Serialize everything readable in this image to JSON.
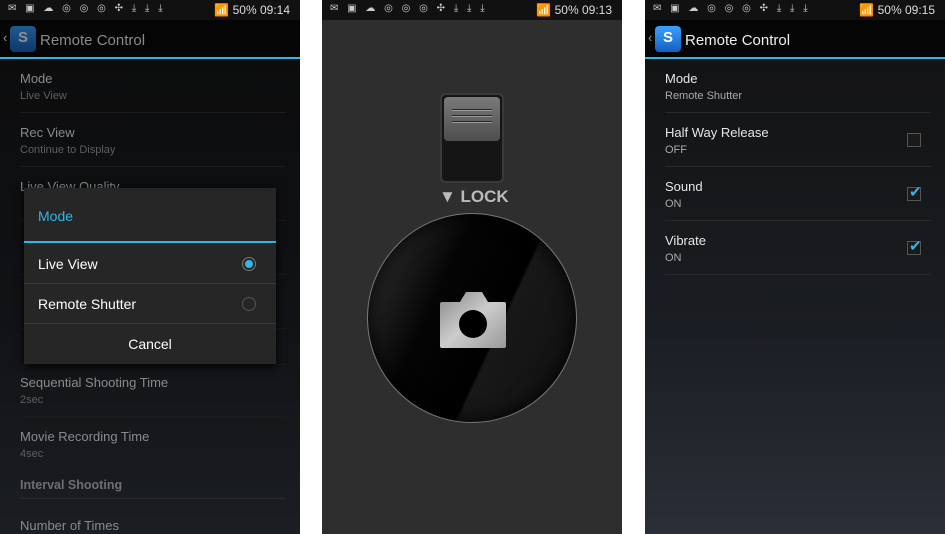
{
  "status_icons": "✉ ▣ ☁ ◎ ◎ ◎ ✣ ⤓ ⤓ ⤓",
  "screens": [
    {
      "status": {
        "battery": "50%",
        "time": "09:14"
      },
      "app_title": "Remote Control",
      "rows": [
        {
          "title": "Mode",
          "sub": "Live View"
        },
        {
          "title": "Rec View",
          "sub": "Continue to Display"
        },
        {
          "title": "Live View Quality",
          "sub": ""
        }
      ],
      "rows_below": [
        {
          "title": "Sequential Shooting Time",
          "sub": "2sec"
        },
        {
          "title": "Movie Recording Time",
          "sub": "4sec"
        }
      ],
      "section": "Interval Shooting",
      "last_row": "Number of Times",
      "dialog": {
        "title": "Mode",
        "options": [
          {
            "label": "Live View",
            "selected": true
          },
          {
            "label": "Remote Shutter",
            "selected": false
          }
        ],
        "cancel": "Cancel"
      }
    },
    {
      "status": {
        "battery": "50%",
        "time": "09:13"
      },
      "lock_label": "▼ LOCK"
    },
    {
      "status": {
        "battery": "50%",
        "time": "09:15"
      },
      "app_title": "Remote Control",
      "rows": [
        {
          "title": "Mode",
          "sub": "Remote Shutter"
        },
        {
          "title": "Half Way Release",
          "sub": "OFF",
          "checked": false
        },
        {
          "title": "Sound",
          "sub": "ON",
          "checked": true
        },
        {
          "title": "Vibrate",
          "sub": "ON",
          "checked": true
        }
      ]
    }
  ],
  "accent": "#33b5e5"
}
